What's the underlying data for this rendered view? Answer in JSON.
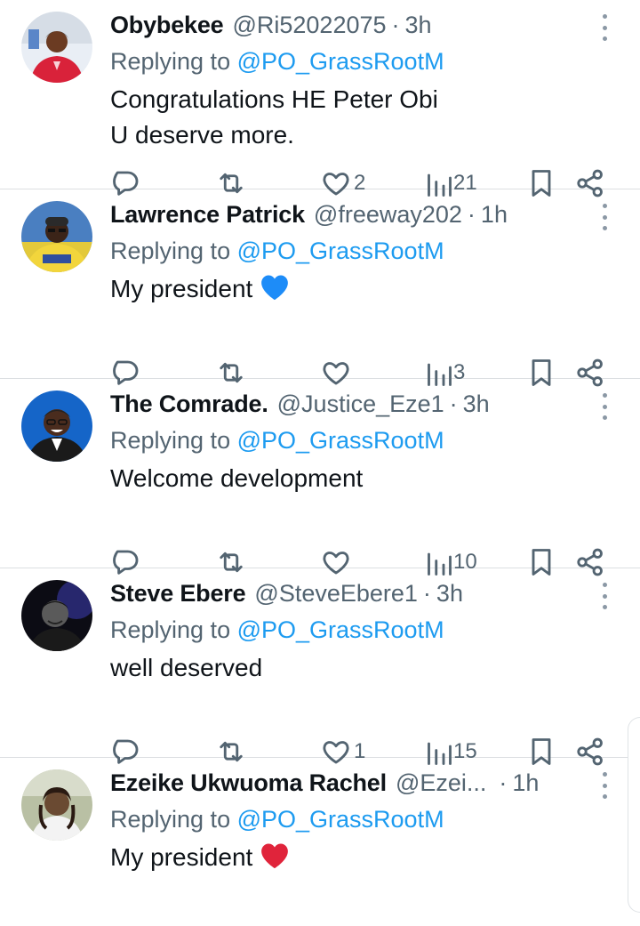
{
  "tweets": [
    {
      "name": "Obybekee",
      "handle": "@Ri52022075",
      "time": "3h",
      "replying_prefix": "Replying to ",
      "replying_to": "@PO_GrassRootM",
      "text_lines": [
        "Congratulations HE Peter Obi",
        "U deserve more."
      ],
      "emoji": "",
      "likes": "2",
      "views": "21"
    },
    {
      "name": "Lawrence Patrick",
      "handle": "@freeway202",
      "time": "1h",
      "replying_prefix": "Replying to ",
      "replying_to": "@PO_GrassRootM",
      "text_lines": [
        "My president"
      ],
      "emoji": "blue-heart",
      "likes": "",
      "views": "3"
    },
    {
      "name": "The Comrade.",
      "handle": "@Justice_Eze1",
      "time": "3h",
      "replying_prefix": "Replying to ",
      "replying_to": "@PO_GrassRootM",
      "text_lines": [
        "Welcome development"
      ],
      "emoji": "",
      "likes": "",
      "views": "10"
    },
    {
      "name": "Steve Ebere",
      "handle": "@SteveEbere1",
      "time": "3h",
      "replying_prefix": "Replying to ",
      "replying_to": "@PO_GrassRootM",
      "text_lines": [
        "well deserved"
      ],
      "emoji": "",
      "likes": "1",
      "views": "15"
    },
    {
      "name": "Ezeike Ukwuoma Rachel",
      "handle": "@Ezei...",
      "time": "1h",
      "replying_prefix": "Replying to ",
      "replying_to": "@PO_GrassRootM",
      "text_lines": [
        "My president"
      ],
      "emoji": "red-heart",
      "likes": "",
      "views": ""
    }
  ],
  "icons": {
    "reply": "reply-icon",
    "retweet": "retweet-icon",
    "like": "heart-icon",
    "views": "views-icon",
    "bookmark": "bookmark-icon",
    "share": "share-icon",
    "more": "more-options-icon"
  },
  "colors": {
    "text": "#0f1419",
    "secondary": "#536471",
    "accent": "#1d9bf0",
    "divider": "#dcdfe2",
    "blue_heart": "#1d8cf8",
    "red_heart": "#e0243b"
  }
}
